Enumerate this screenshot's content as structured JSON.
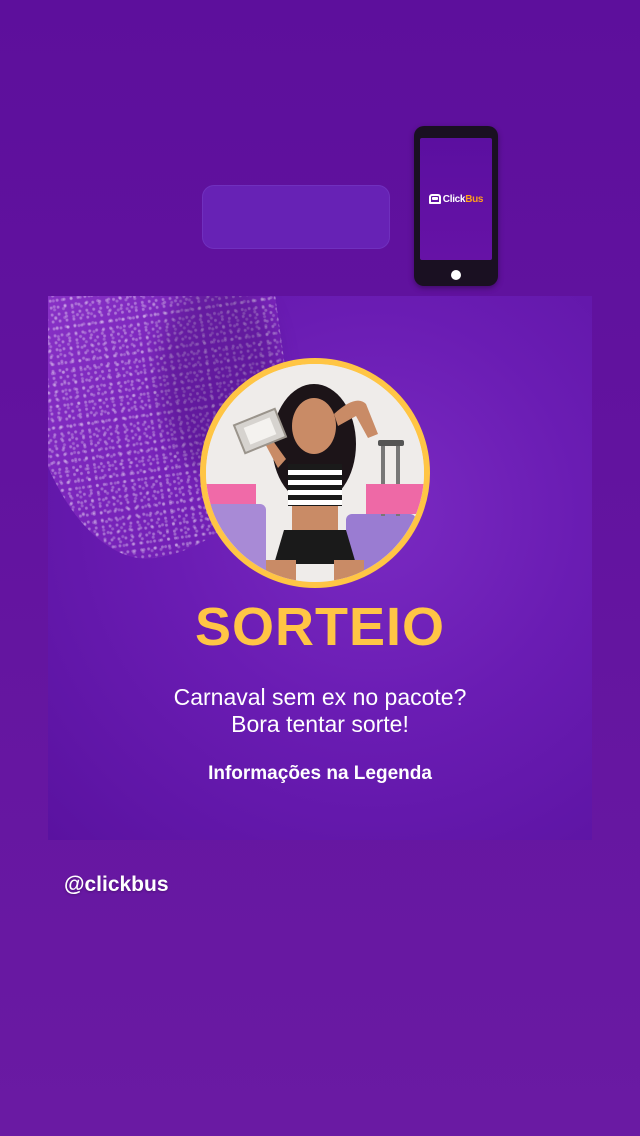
{
  "story": {
    "phone_sticker": {
      "logo_click": "Click",
      "logo_bus": "Bus",
      "icon": "bus-icon"
    },
    "post": {
      "title": "SORTEIO",
      "subtitle_line1": "Carnaval sem ex no pacote?",
      "subtitle_line2": "Bora tentar sorte!",
      "info": "Informações na Legenda"
    },
    "mention": "@clickbus"
  },
  "colors": {
    "background": "#62139f",
    "accent": "#ffc545",
    "logo_bus": "#ff9f1a"
  }
}
